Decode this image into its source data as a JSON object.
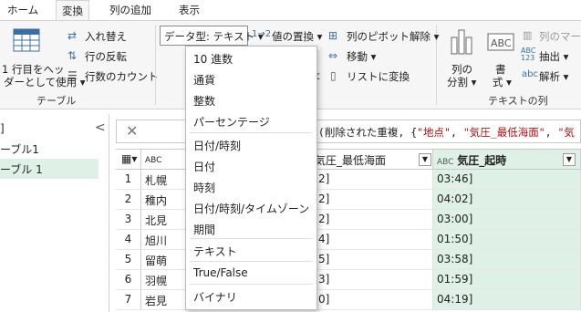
{
  "tabs": [
    "ホーム",
    "変換",
    "列の追加",
    "表示"
  ],
  "ribbon": {
    "first_row_header_line1": "1 行目をヘッ",
    "first_row_header_line2": "ダーとして使用",
    "transpose": "入れ替え",
    "reverse_rows": "行の反転",
    "count_rows": "行数のカウント",
    "group_table": "テーブル",
    "data_type": "データ型: テキスト",
    "replace_values": "値の置換",
    "unpivot": "列のピボット解除",
    "move": "移動",
    "to_list": "リストに変換",
    "split_col_1": "列の",
    "split_col_2": "分割",
    "format_1": "書",
    "format_2": "式",
    "merge": "列のマージ",
    "extract": "抽出",
    "parse": "解析",
    "group_text": "テキストの列"
  },
  "queries": {
    "collapse": "<",
    "items": [
      "]",
      "ーブル1",
      "ーブル 1"
    ]
  },
  "formula": {
    "prefix": "t(削除された重複, {",
    "s1": "\"地点\"",
    "sep1": ", ",
    "s2": "\"気圧_最低海面\"",
    "sep2": ", ",
    "s3": "\"気"
  },
  "grid": {
    "headers": {
      "col1_type": "ABC",
      "col2_label": "気圧_最低海面",
      "col3_type": "ABC",
      "col3_label": "気圧_起時"
    },
    "rows": [
      {
        "n": "1",
        "c1": "札幌",
        "c2": "2]",
        "c3": "03:46]"
      },
      {
        "n": "2",
        "c1": "稚内",
        "c2": "2]",
        "c3": "04:02]"
      },
      {
        "n": "3",
        "c1": "北見",
        "c2": "2]",
        "c3": "03:00]"
      },
      {
        "n": "4",
        "c1": "旭川",
        "c2": "4]",
        "c3": "01:50]"
      },
      {
        "n": "5",
        "c1": "留萌",
        "c2": "5]",
        "c3": "03:58]"
      },
      {
        "n": "6",
        "c1": "羽幌",
        "c2": "3]",
        "c3": "01:59]"
      },
      {
        "n": "7",
        "c1": "岩見",
        "c2": "0]",
        "c3": "04:19]"
      }
    ]
  },
  "menu": {
    "items": [
      "10 進数",
      "通貨",
      "整数",
      "パーセンテージ",
      "日付/時刻",
      "日付",
      "時刻",
      "日付/時刻/タイムゾーン",
      "期間",
      "テキスト",
      "True/False",
      "バイナリ"
    ]
  },
  "colors": {
    "selected_column": "#dff0e6",
    "accent": "#217346"
  }
}
